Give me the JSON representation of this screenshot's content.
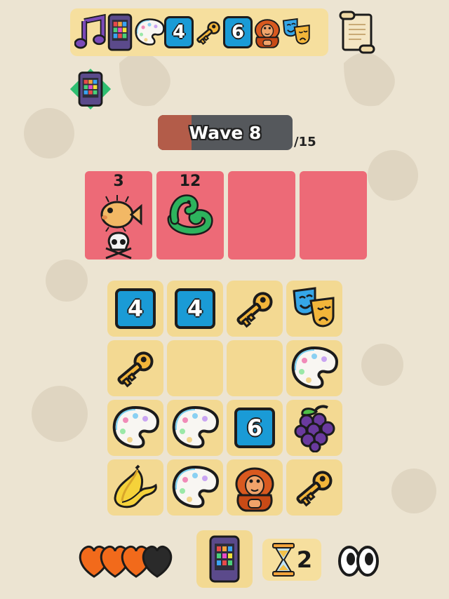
{
  "inventory": {
    "items": [
      {
        "icon": "music-note-icon"
      },
      {
        "icon": "phone-icon"
      },
      {
        "icon": "palette-icon"
      },
      {
        "icon": "number-tile-icon",
        "value": "4"
      },
      {
        "icon": "key-icon"
      },
      {
        "icon": "number-tile-icon",
        "value": "6"
      },
      {
        "icon": "orangutan-icon"
      },
      {
        "icon": "theater-masks-icon"
      }
    ],
    "scroll_icon": "scroll-icon"
  },
  "selected_item_icon": "phone-icon",
  "wave": {
    "label": "Wave 8",
    "total": "/15",
    "progress": 0.25,
    "colors": {
      "track": "#55585c",
      "fill": "#b35c49"
    }
  },
  "enemies": [
    {
      "hp": "3",
      "icon": "pufferfish-icon",
      "status_icon": "skull-crossbones-icon"
    },
    {
      "hp": "12",
      "icon": "snake-icon"
    },
    {
      "hp": ""
    },
    {
      "hp": ""
    }
  ],
  "grid": [
    [
      {
        "type": "number",
        "value": "4"
      },
      {
        "type": "number",
        "value": "4"
      },
      {
        "type": "key"
      },
      {
        "type": "masks"
      }
    ],
    [
      {
        "type": "key"
      },
      {
        "type": "empty"
      },
      {
        "type": "empty"
      },
      {
        "type": "palette"
      }
    ],
    [
      {
        "type": "palette"
      },
      {
        "type": "palette"
      },
      {
        "type": "number",
        "value": "6"
      },
      {
        "type": "grapes"
      }
    ],
    [
      {
        "type": "banana"
      },
      {
        "type": "palette"
      },
      {
        "type": "orangutan"
      },
      {
        "type": "key"
      }
    ]
  ],
  "lives": {
    "filled": 3,
    "total": 4,
    "colors": {
      "full": "#f26a1b",
      "empty": "#2a2a2a"
    }
  },
  "timer": {
    "icon": "hourglass-icon",
    "count": "2"
  },
  "eyes_icon": "eyes-icon",
  "colors": {
    "background": "#ece4d2",
    "cell": "#f3d992",
    "enemy_card": "#ed6a77",
    "number_tile": "#1a9bd6"
  }
}
